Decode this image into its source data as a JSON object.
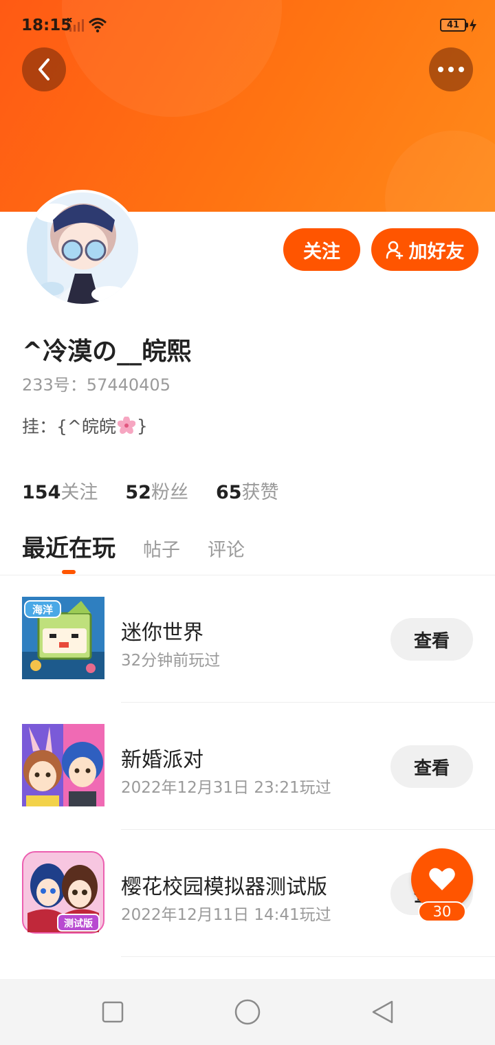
{
  "status_bar": {
    "time": "18:15",
    "battery": "41"
  },
  "profile": {
    "username": "^冷漠の__皖熙",
    "id_text": "233号：57440405",
    "bio_prefix": "挂：{^皖皖",
    "bio_suffix": "}"
  },
  "actions": {
    "follow_label": "关注",
    "add_friend_label": "加好友"
  },
  "stats": [
    {
      "value": "154",
      "label": "关注"
    },
    {
      "value": "52",
      "label": "粉丝"
    },
    {
      "value": "65",
      "label": "获赞"
    }
  ],
  "tabs": [
    "最近在玩",
    "帖子",
    "评论"
  ],
  "games": [
    {
      "title": "迷你世界",
      "time": "32分钟前玩过",
      "button": "查看",
      "badge": "海洋"
    },
    {
      "title": "新婚派对",
      "time": "2022年12月31日 23:21玩过",
      "button": "查看"
    },
    {
      "title": "樱花校园模拟器测试版",
      "time": "2022年12月11日 14:41玩过",
      "button": "查看",
      "badge": "测试版"
    }
  ],
  "like": {
    "count": "30"
  },
  "colors": {
    "accent": "#ff5500",
    "header": "#ff6a10"
  }
}
